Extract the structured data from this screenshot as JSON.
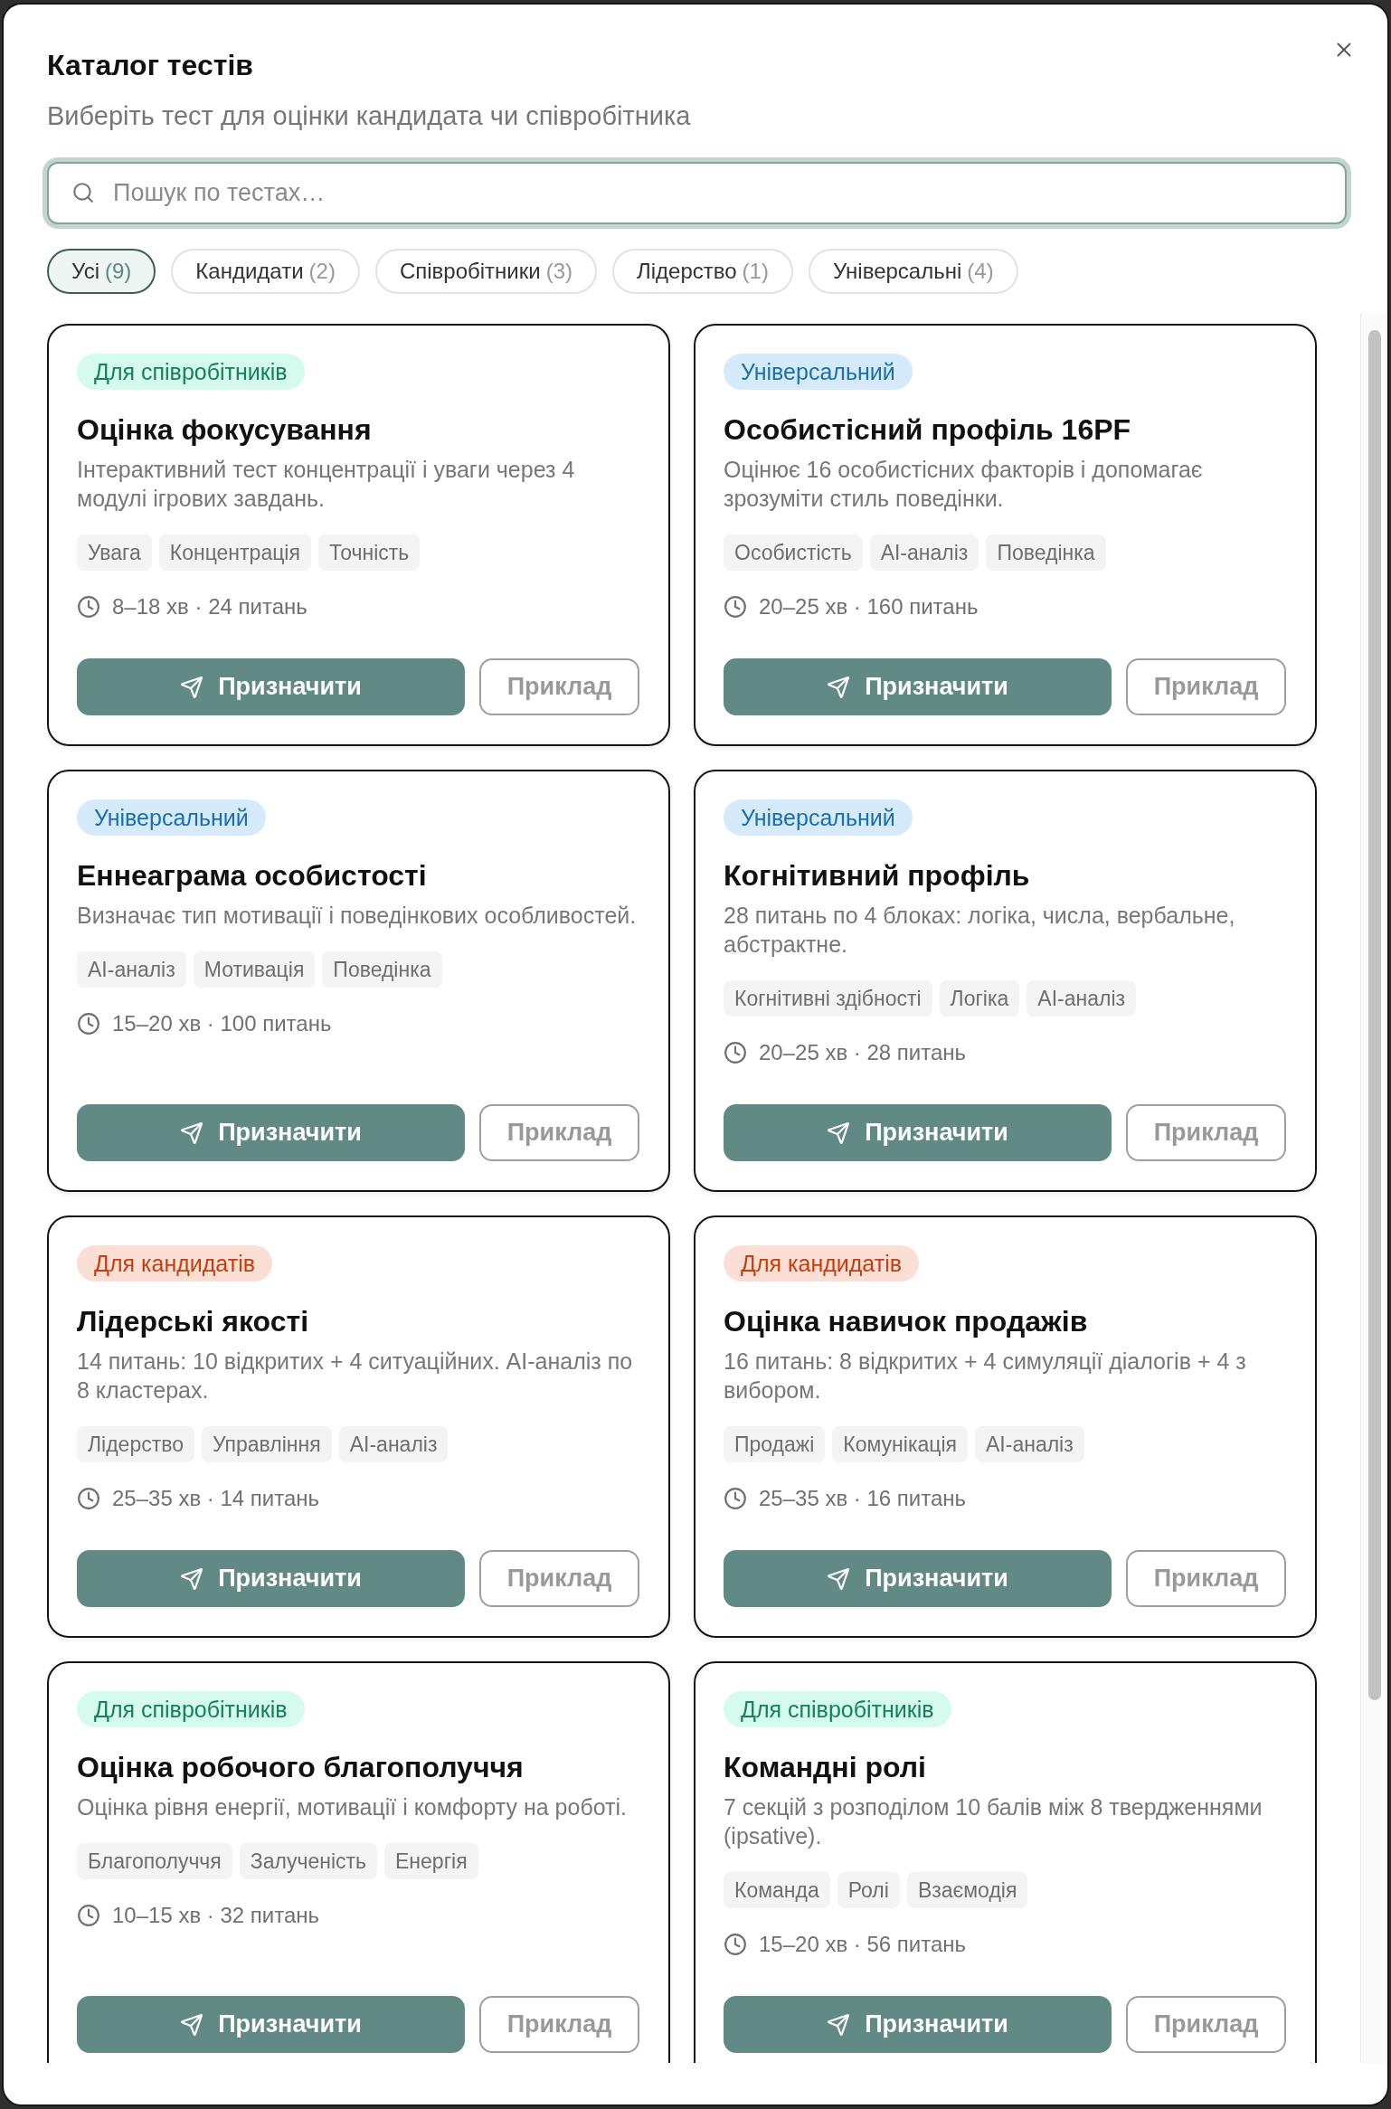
{
  "dialog": {
    "title": "Каталог тестів",
    "subtitle": "Виберіть тест для оцінки кандидата чи співробітника"
  },
  "search": {
    "placeholder": "Пошук по тестах…"
  },
  "filters": [
    {
      "label": "Усі",
      "count": "(9)",
      "selected": true
    },
    {
      "label": "Кандидати",
      "count": "(2)",
      "selected": false
    },
    {
      "label": "Співробітники",
      "count": "(3)",
      "selected": false
    },
    {
      "label": "Лідерство",
      "count": "(1)",
      "selected": false
    },
    {
      "label": "Універсальні",
      "count": "(4)",
      "selected": false
    }
  ],
  "cards": [
    {
      "badge": {
        "label": "Для співробітників",
        "color": "#15805a"
      },
      "title": "Оцінка фокусування",
      "description": "Інтерактивний тест концентрації і уваги через 4 модулі ігрових завдань.",
      "tags": [
        "Увага",
        "Концентрація",
        "Точність"
      ],
      "meta": "8–18 хв · 24 питань",
      "primary_button": "Призначити",
      "secondary_button": "Приклад"
    },
    {
      "badge": {
        "label": "Універсальний",
        "color": "#1a6fb0"
      },
      "title": "Особистісний профіль 16PF",
      "description": "Оцінює 16 особистісних факторів і допомагає зрозуміти стиль поведінки.",
      "tags": [
        "Особистість",
        "AI-аналіз",
        "Поведінка"
      ],
      "meta": "20–25 хв · 160 питань",
      "primary_button": "Призначити",
      "secondary_button": "Приклад"
    },
    {
      "badge": {
        "label": "Універсальний",
        "color": "#1a6fb0"
      },
      "title": "Еннеаграма особистості",
      "description": "Визначає тип мотивації і поведінкових особливостей.",
      "tags": [
        "AI-аналіз",
        "Мотивація",
        "Поведінка"
      ],
      "meta": "15–20 хв · 100 питань",
      "primary_button": "Призначити",
      "secondary_button": "Приклад"
    },
    {
      "badge": {
        "label": "Універсальний",
        "color": "#1a6fb0"
      },
      "title": "Когнітивний профіль",
      "description": "28 питань по 4 блоках: логіка, числа, вербальне, абстрактне.",
      "tags": [
        "Когнітивні здібності",
        "Логіка",
        "AI-аналіз"
      ],
      "meta": "20–25 хв · 28 питань",
      "primary_button": "Призначити",
      "secondary_button": "Приклад"
    },
    {
      "badge": {
        "label": "Для кандидатів",
        "color": "#c73e0e"
      },
      "title": "Лідерські якості",
      "description": "14 питань: 10 відкритих + 4 ситуаційних. AI-аналіз по 8 кластерах.",
      "tags": [
        "Лідерство",
        "Управління",
        "AI-аналіз"
      ],
      "meta": "25–35 хв · 14 питань",
      "primary_button": "Призначити",
      "secondary_button": "Приклад"
    },
    {
      "badge": {
        "label": "Для кандидатів",
        "color": "#c73e0e"
      },
      "title": "Оцінка навичок продажів",
      "description": "16 питань: 8 відкритих + 4 симуляції діалогів + 4 з вибором.",
      "tags": [
        "Продажі",
        "Комунікація",
        "AI-аналіз"
      ],
      "meta": "25–35 хв · 16 питань",
      "primary_button": "Призначити",
      "secondary_button": "Приклад"
    },
    {
      "badge": {
        "label": "Для співробітників",
        "color": "#15805a"
      },
      "title": "Оцінка робочого благополуччя",
      "description": "Оцінка рівня енергії, мотивації і комфорту на роботі.",
      "tags": [
        "Благополуччя",
        "Залученість",
        "Енергія"
      ],
      "meta": "10–15 хв · 32 питань",
      "primary_button": "Призначити",
      "secondary_button": "Приклад"
    },
    {
      "badge": {
        "label": "Для співробітників",
        "color": "#15805a"
      },
      "title": "Командні ролі",
      "description": "7 секцій з розподілом 10 балів між 8 твердженнями (ipsative).",
      "tags": [
        "Команда",
        "Ролі",
        "Взаємодія"
      ],
      "meta": "15–20 хв · 56 питань",
      "primary_button": "Призначити",
      "secondary_button": "Приклад"
    }
  ]
}
